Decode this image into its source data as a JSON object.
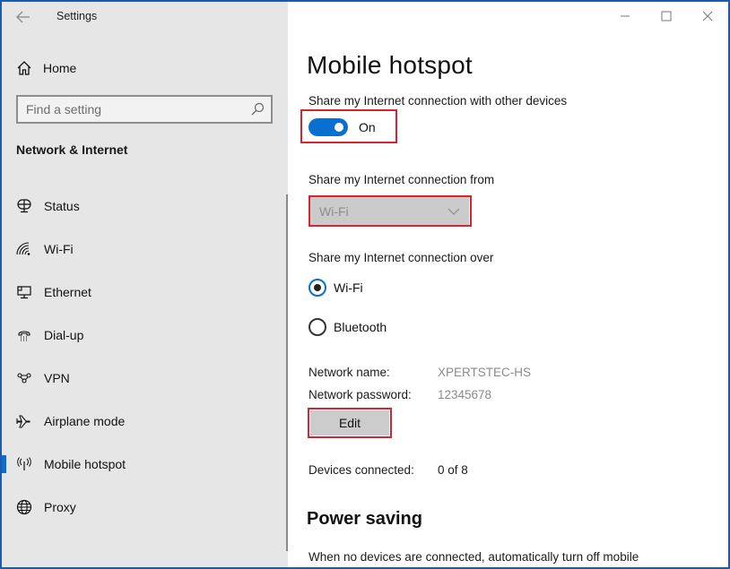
{
  "window": {
    "app_title": "Settings",
    "controls": {
      "minimize": "minimize-icon",
      "maximize": "maximize-icon",
      "close": "close-icon"
    }
  },
  "sidebar": {
    "back_icon": "back-arrow-icon",
    "home_label": "Home",
    "search_placeholder": "Find a setting",
    "section_title": "Network & Internet",
    "items": [
      {
        "label": "Status",
        "icon": "globe-monitor-icon",
        "active": false
      },
      {
        "label": "Wi-Fi",
        "icon": "wifi-icon",
        "active": false
      },
      {
        "label": "Ethernet",
        "icon": "ethernet-icon",
        "active": false
      },
      {
        "label": "Dial-up",
        "icon": "phone-icon",
        "active": false
      },
      {
        "label": "VPN",
        "icon": "vpn-icon",
        "active": false
      },
      {
        "label": "Airplane mode",
        "icon": "airplane-icon",
        "active": false
      },
      {
        "label": "Mobile hotspot",
        "icon": "hotspot-icon",
        "active": true
      },
      {
        "label": "Proxy",
        "icon": "globe-icon",
        "active": false
      }
    ]
  },
  "main": {
    "title": "Mobile hotspot",
    "share_label": "Share my Internet connection with other devices",
    "toggle_state": "On",
    "from_label": "Share my Internet connection from",
    "from_value": "Wi-Fi",
    "over_label": "Share my Internet connection over",
    "over_options": [
      {
        "label": "Wi-Fi",
        "checked": true
      },
      {
        "label": "Bluetooth",
        "checked": false
      }
    ],
    "network_name_label": "Network name:",
    "network_name_value": "XPERTSTEC-HS",
    "network_password_label": "Network password:",
    "network_password_value": "12345678",
    "edit_label": "Edit",
    "devices_label": "Devices connected:",
    "devices_value": "0 of 8",
    "power_title": "Power saving",
    "power_text": "When no devices are connected, automatically turn off mobile"
  },
  "colors": {
    "accent": "#0b6fd0",
    "highlight": "#d42530",
    "sidebar_bg": "#e6e6e6"
  }
}
